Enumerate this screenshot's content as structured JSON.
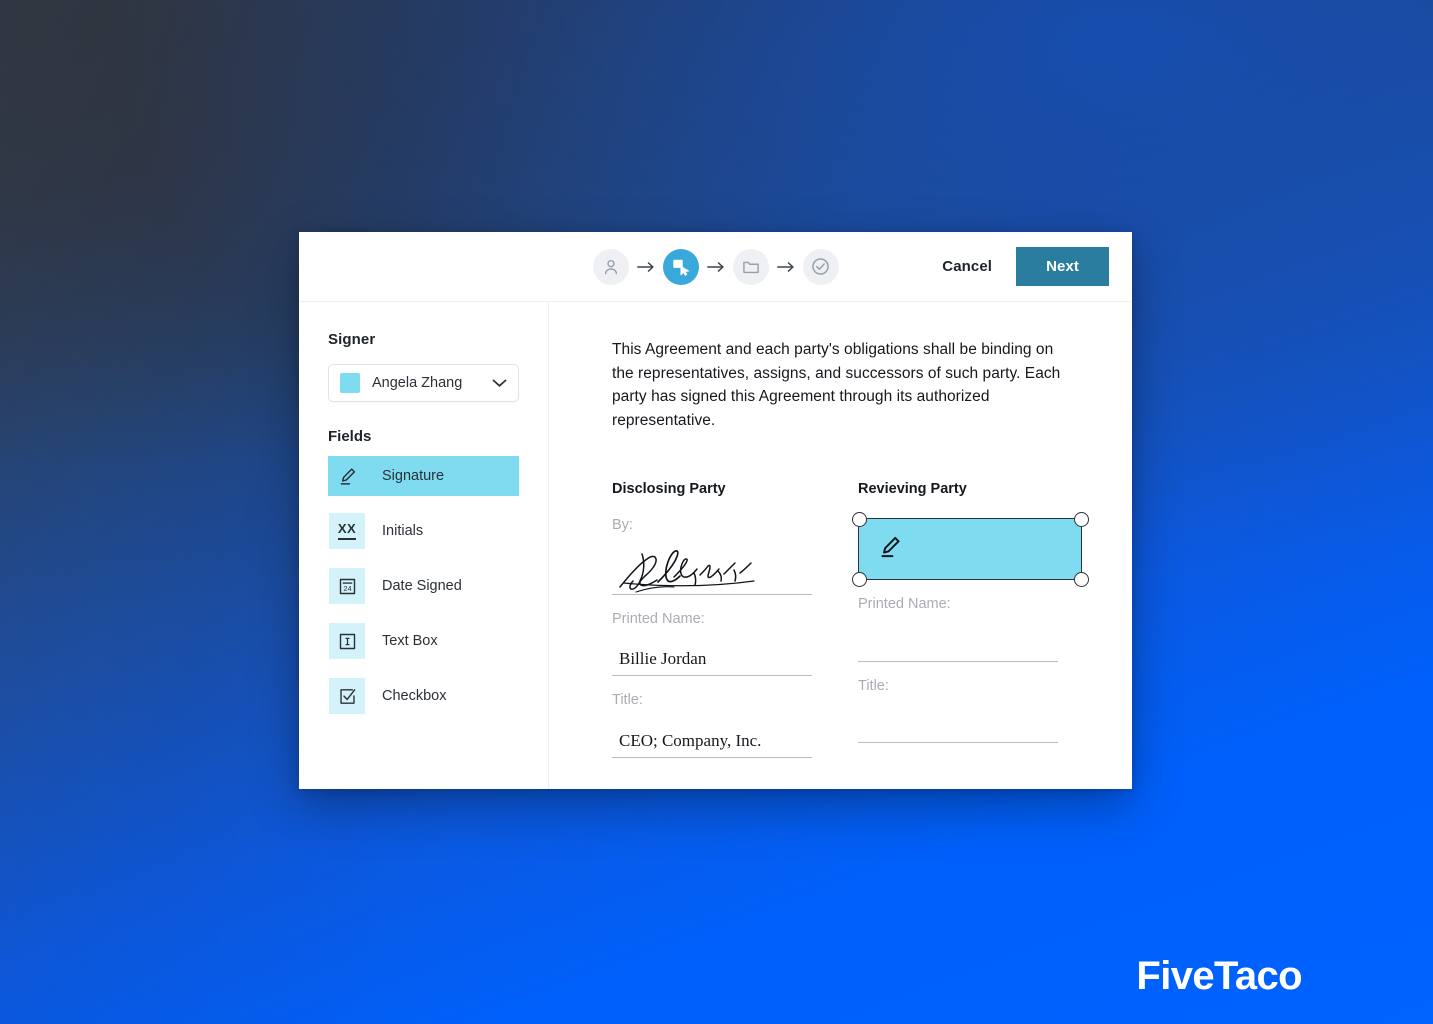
{
  "app": {
    "window_title": "E-Signature Field Placement"
  },
  "topbar": {
    "steps": [
      {
        "icon": "person-icon",
        "name": "step-recipients",
        "state": "inactive"
      },
      {
        "icon": "place-fields-icon",
        "name": "step-place-fields",
        "state": "active"
      },
      {
        "icon": "folder-icon",
        "name": "step-documents",
        "state": "inactive"
      },
      {
        "icon": "check-circle-icon",
        "name": "step-review",
        "state": "inactive"
      }
    ],
    "arrow_glyph": "→",
    "cancel_label": "Cancel",
    "next_label": "Next",
    "next_button_color": "#2b7d9f",
    "active_step_color": "#39a9dc"
  },
  "sidebar": {
    "signer_heading": "Signer",
    "signer": {
      "name": "Angela Zhang",
      "swatch_color": "#7fdcf0",
      "chevron": "chevron-down-icon"
    },
    "fields_heading": "Fields",
    "fields": [
      {
        "label": "Signature",
        "icon": "pen-signature-icon",
        "selected": true
      },
      {
        "label": "Initials",
        "icon": "initials-xx-icon",
        "selected": false
      },
      {
        "label": "Date Signed",
        "icon": "calendar-24-icon",
        "selected": false
      },
      {
        "label": "Text Box",
        "icon": "text-cursor-icon",
        "selected": false
      },
      {
        "label": "Checkbox",
        "icon": "checkbox-check-icon",
        "selected": false
      }
    ],
    "selected_highlight_color": "#7fdcf0",
    "icon_tile_color": "#d4f2fa"
  },
  "document": {
    "paragraph": "This Agreement and each party's obligations shall be binding on the representatives, assigns, and successors of such party. Each party has signed this Agreement through its authorized representative.",
    "disclosing_party": {
      "title": "Disclosing Party",
      "by_label": "By:",
      "signature_present": true,
      "printed_name_label": "Printed Name:",
      "printed_name_value": "Billie Jordan",
      "title_label": "Title:",
      "title_value": "CEO; Company, Inc."
    },
    "reviewing_party": {
      "title": "Revieving Party",
      "signature_field": {
        "icon": "pen-signature-icon",
        "selected": true,
        "fill_color": "#7fdcf0",
        "border_color": "#2d3238",
        "handles": 4
      },
      "printed_name_label": "Printed Name:",
      "printed_name_value": "",
      "title_label": "Title:",
      "title_value": ""
    }
  },
  "brand": {
    "name": "FiveTaco"
  },
  "background": {
    "top_left_color": "#2d3440",
    "top_right_color": "#1a4fa8",
    "bottom_color": "#0060fb"
  }
}
